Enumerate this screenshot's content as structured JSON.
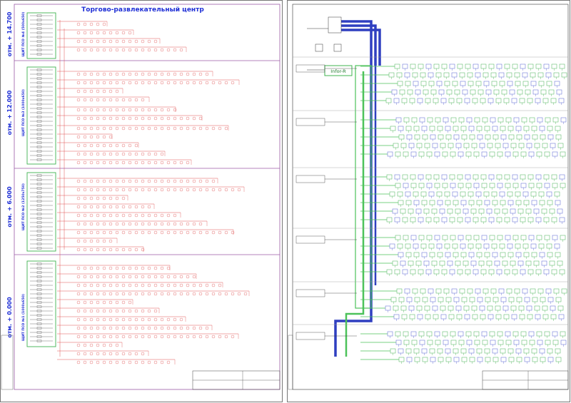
{
  "left_sheet": {
    "title": "Торгово-развлекательный центр",
    "floors": [
      {
        "elevation": "отм. + 14.700",
        "panel": "ЩИТ ПСО №4 (500х650)"
      },
      {
        "elevation": "отм. + 12.000",
        "panel": "ЩИТ ПСО №3 (1000х650)"
      },
      {
        "elevation": "отм. + 6.000",
        "panel": "ЩИТ ПСО №2 (1250х750)"
      },
      {
        "elevation": "отм. + 0.000",
        "panel": "ЩИТ ПСО №1 (1000х650)"
      }
    ]
  },
  "right_sheet": {
    "hub_label": "Infor-R"
  },
  "colors": {
    "frame": "#9b5aa6",
    "left_wiring": "#e05050",
    "panel_green": "#3fb34f",
    "title": "#1f2fd6",
    "bus_blue": "#2f3fc0",
    "bus_green": "#4cc25a",
    "device_green": "#46b052",
    "device_blue": "#5560d0"
  }
}
